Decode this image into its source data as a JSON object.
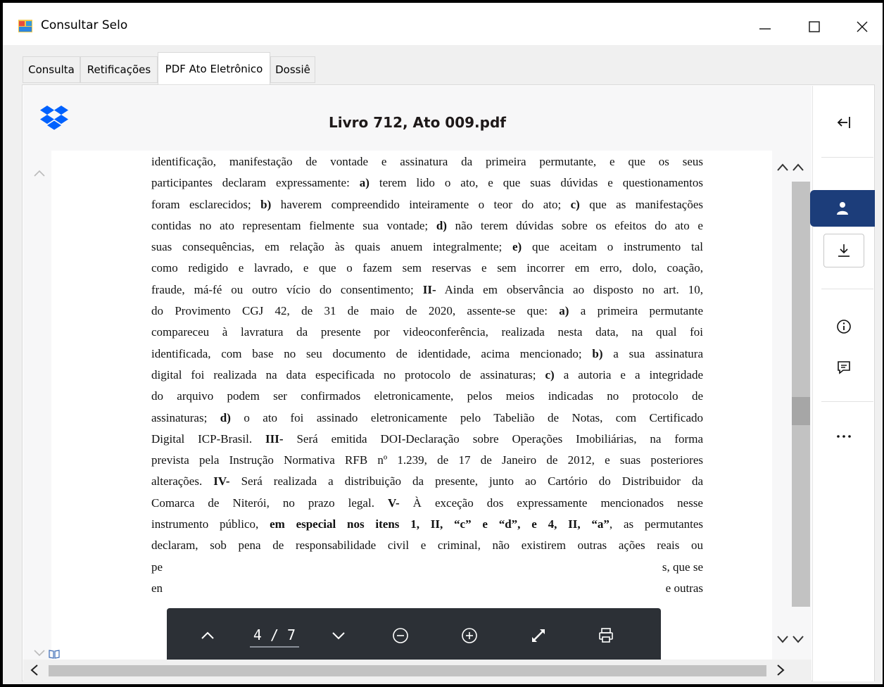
{
  "window": {
    "title": "Consultar Selo"
  },
  "tabs": [
    {
      "label": "Consulta"
    },
    {
      "label": "Retificações"
    },
    {
      "label": "PDF Ato Eletrônico"
    },
    {
      "label": "Dossiê"
    }
  ],
  "active_tab": "PDF Ato Eletrônico",
  "viewer": {
    "file_name": "Livro 712, Ato 009.pdf",
    "page_indicator": "4 / 7",
    "current_page": 4,
    "total_pages": 7
  },
  "document_lines": [
    {
      "parts": [
        {
          "t": "identificação, manifestação de vontade e assinatura da primeira permutante, e que os seus"
        }
      ]
    },
    {
      "parts": [
        {
          "t": "participantes declaram expressamente: "
        },
        {
          "t": "a)",
          "b": true
        },
        {
          "t": " terem lido o ato, e que suas dúvidas e questionamentos"
        }
      ]
    },
    {
      "parts": [
        {
          "t": "foram esclarecidos; "
        },
        {
          "t": "b)",
          "b": true
        },
        {
          "t": " haverem compreendido inteiramente o teor do ato; "
        },
        {
          "t": "c)",
          "b": true
        },
        {
          "t": " que as manifestações"
        }
      ]
    },
    {
      "parts": [
        {
          "t": "contidas no ato representam fielmente sua vontade; "
        },
        {
          "t": "d)",
          "b": true
        },
        {
          "t": " não terem dúvidas sobre os efeitos do ato e"
        }
      ]
    },
    {
      "parts": [
        {
          "t": "suas consequências, em relação às quais anuem integralmente; "
        },
        {
          "t": "e)",
          "b": true
        },
        {
          "t": " que aceitam o instrumento tal"
        }
      ]
    },
    {
      "parts": [
        {
          "t": "como redigido e lavrado, e que o fazem sem reservas e sem incorrer em erro, dolo, coação,"
        }
      ]
    },
    {
      "parts": [
        {
          "t": "fraude, má-fé ou outro vício do consentimento; "
        },
        {
          "t": "II-",
          "b": true
        },
        {
          "t": " Ainda em observância ao disposto no art. 10,"
        }
      ]
    },
    {
      "parts": [
        {
          "t": "do Provimento CGJ 42, de 31 de maio de 2020, assente-se que: "
        },
        {
          "t": "a)",
          "b": true
        },
        {
          "t": " a primeira permutante"
        }
      ]
    },
    {
      "parts": [
        {
          "t": "compareceu à lavratura da presente por videoconferência, realizada nesta data, na qual foi"
        }
      ]
    },
    {
      "parts": [
        {
          "t": "identificada, com base no seu documento de identidade, acima mencionado; "
        },
        {
          "t": "b)",
          "b": true
        },
        {
          "t": " a sua assinatura"
        }
      ]
    },
    {
      "parts": [
        {
          "t": "digital foi realizada na data especificada no protocolo de assinaturas; "
        },
        {
          "t": "c)",
          "b": true
        },
        {
          "t": " a autoria e a integridade"
        }
      ]
    },
    {
      "parts": [
        {
          "t": "do arquivo podem ser confirmados eletronicamente, pelos meios indicadas no protocolo de"
        }
      ]
    },
    {
      "parts": [
        {
          "t": "assinaturas; "
        },
        {
          "t": "d)",
          "b": true
        },
        {
          "t": " o ato foi assinado eletronicamente pelo Tabelião de Notas, com Certificado"
        }
      ]
    },
    {
      "parts": [
        {
          "t": "Digital ICP-Brasil. "
        },
        {
          "t": "III-",
          "b": true
        },
        {
          "t": " Será emitida DOI-Declaração sobre Operações Imobiliárias, na forma"
        }
      ]
    },
    {
      "parts": [
        {
          "t": "prevista pela Instrução Normativa RFB nº 1.239, de 17 de Janeiro de 2012, e suas posteriores"
        }
      ]
    },
    {
      "parts": [
        {
          "t": "alterações. "
        },
        {
          "t": "IV-",
          "b": true
        },
        {
          "t": " Será realizada a distribuição da presente, junto ao Cartório do Distribuidor da"
        }
      ]
    },
    {
      "parts": [
        {
          "t": "Comarca de Niterói, no prazo legal. "
        },
        {
          "t": "V-",
          "b": true
        },
        {
          "t": " À exceção dos expressamente mencionados nesse"
        }
      ]
    },
    {
      "parts": [
        {
          "t": "instrumento público, "
        },
        {
          "t": "em especial nos itens 1, II, “c” e “d”, e 4, II, “a”",
          "b": true
        },
        {
          "t": ", as permutantes"
        }
      ]
    },
    {
      "parts": [
        {
          "t": "declaram, sob pena de responsabilidade civil e criminal, não existirem outras ações reais ou"
        }
      ]
    },
    {
      "parts": [
        {
          "t": "pe"
        }
      ],
      "tail": "s, que se"
    },
    {
      "parts": [
        {
          "t": "en"
        }
      ],
      "tail": "e outras"
    }
  ],
  "toolbar": {
    "prev_icon": "chevron-up-icon",
    "next_icon": "chevron-down-icon",
    "zoom_out_icon": "minus-circle-icon",
    "zoom_in_icon": "plus-circle-icon",
    "fullscreen_icon": "expand-icon",
    "print_icon": "printer-icon"
  },
  "side_rail": {
    "collapse_icon": "arrow-left-bar-icon",
    "person_icon": "person-icon",
    "download_icon": "download-icon",
    "info_icon": "info-icon",
    "comment_icon": "comment-icon",
    "more_icon": "more-horizontal-icon"
  },
  "colors": {
    "rail_active": "#1c3d7a",
    "toolbar_bg": "#2c3036",
    "dropbox_blue": "#0061fe"
  }
}
